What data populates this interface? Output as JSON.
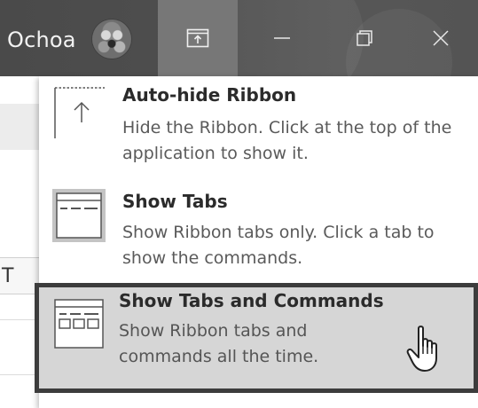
{
  "titlebar": {
    "user_name": "Ochoa",
    "buttons": [
      {
        "name": "ribbon-display-options",
        "icon": "ribbon-display-options-icon"
      },
      {
        "name": "minimize",
        "icon": "minimize-icon"
      },
      {
        "name": "maximize",
        "icon": "maximize-icon"
      },
      {
        "name": "close",
        "icon": "close-icon"
      }
    ]
  },
  "document": {
    "visible_column_letter": "T"
  },
  "menu": {
    "items": [
      {
        "title": "Auto-hide Ribbon",
        "description": "Hide the Ribbon. Click at the top of the application to show it.",
        "icon": "auto-hide-ribbon-icon",
        "selected": false
      },
      {
        "title": "Show Tabs",
        "description": "Show Ribbon tabs only. Click a tab to show the commands.",
        "icon": "show-tabs-icon",
        "selected": false
      },
      {
        "title": "Show Tabs and Commands",
        "description": "Show Ribbon tabs and commands all the time.",
        "icon": "show-tabs-and-commands-icon",
        "selected": true
      }
    ]
  },
  "colors": {
    "titlebar_bg": "#4e4e4e",
    "active_button_bg": "#777777",
    "selected_item_bg": "#d6d6d6",
    "selected_item_border": "#3c3c3c"
  }
}
